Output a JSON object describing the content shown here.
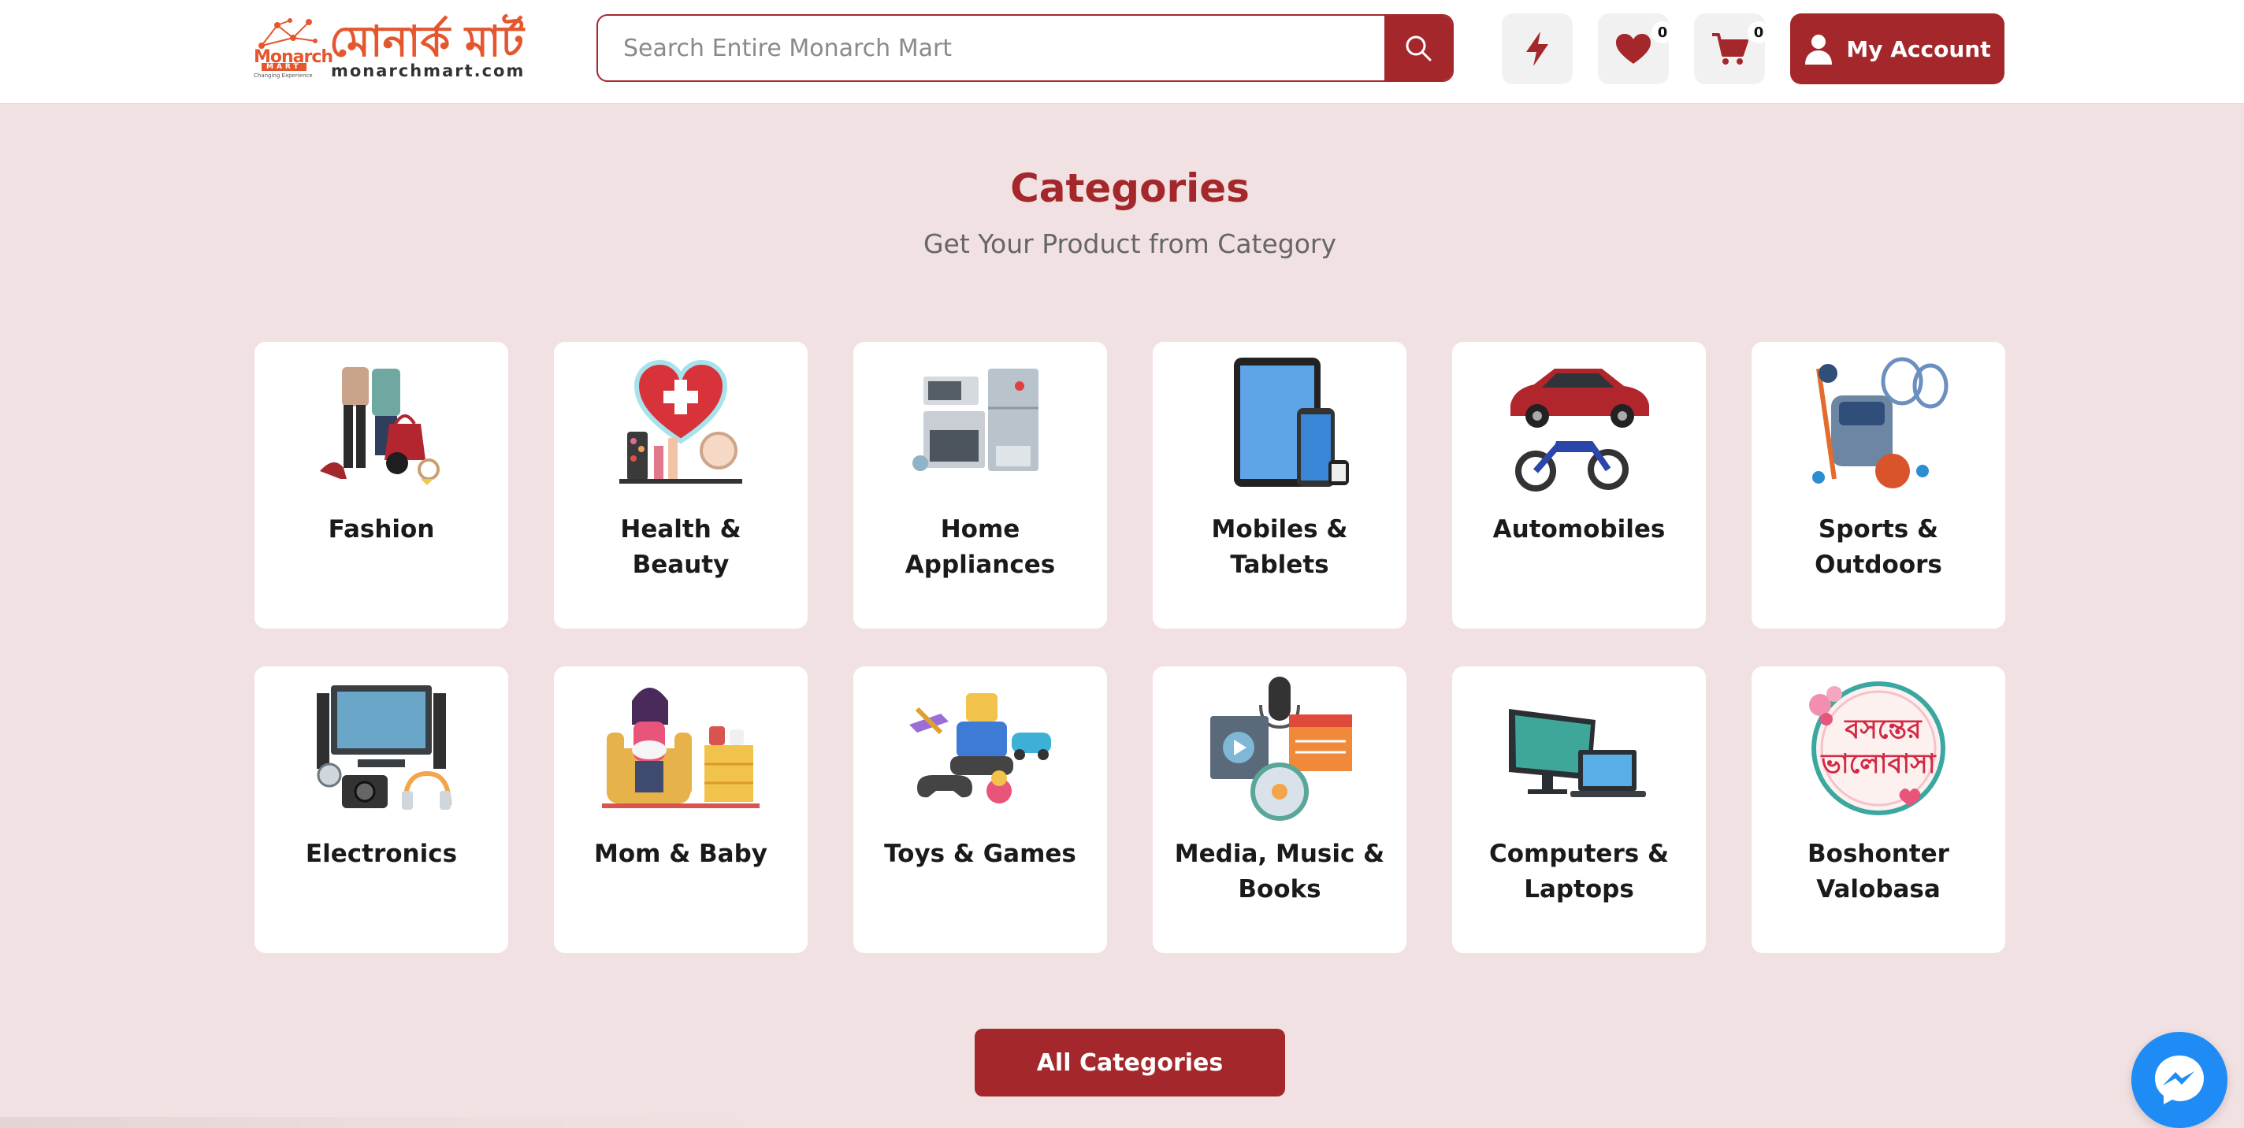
{
  "header": {
    "logo": {
      "brand": "Monarch",
      "mart": "MART",
      "tagline": "Changing Experience",
      "bengali_name": "মোনার্ক মার্ট",
      "url": "monarchmart.com"
    },
    "search": {
      "placeholder": "Search Entire Monarch Mart",
      "value": ""
    },
    "wishlist_count": "0",
    "cart_count": "0",
    "account_label": "My Account"
  },
  "section": {
    "title": "Categories",
    "subtitle": "Get Your Product from Category"
  },
  "categories": [
    {
      "label": "Fashion",
      "icon": "fashion-icon"
    },
    {
      "label": "Health & Beauty",
      "icon": "health-beauty-icon"
    },
    {
      "label": "Home Appliances",
      "icon": "home-appliances-icon"
    },
    {
      "label": "Mobiles & Tablets",
      "icon": "mobiles-tablets-icon"
    },
    {
      "label": "Automobiles",
      "icon": "automobiles-icon"
    },
    {
      "label": "Sports & Outdoors",
      "icon": "sports-outdoors-icon"
    },
    {
      "label": "Electronics",
      "icon": "electronics-icon"
    },
    {
      "label": "Mom & Baby",
      "icon": "mom-baby-icon"
    },
    {
      "label": "Toys & Games",
      "icon": "toys-games-icon"
    },
    {
      "label": "Media, Music & Books",
      "icon": "media-music-books-icon"
    },
    {
      "label": "Computers & Laptops",
      "icon": "computers-laptops-icon"
    },
    {
      "label": "Boshonter Valobasa",
      "icon": "boshonter-valobasa-icon",
      "art_text": "বসন্তের ভালোবাসা"
    }
  ],
  "all_categories_label": "All Categories",
  "colors": {
    "accent": "#a4282b",
    "logo": "#e4572e",
    "background": "#f2e1e2",
    "messenger": "#1f8bf5"
  }
}
